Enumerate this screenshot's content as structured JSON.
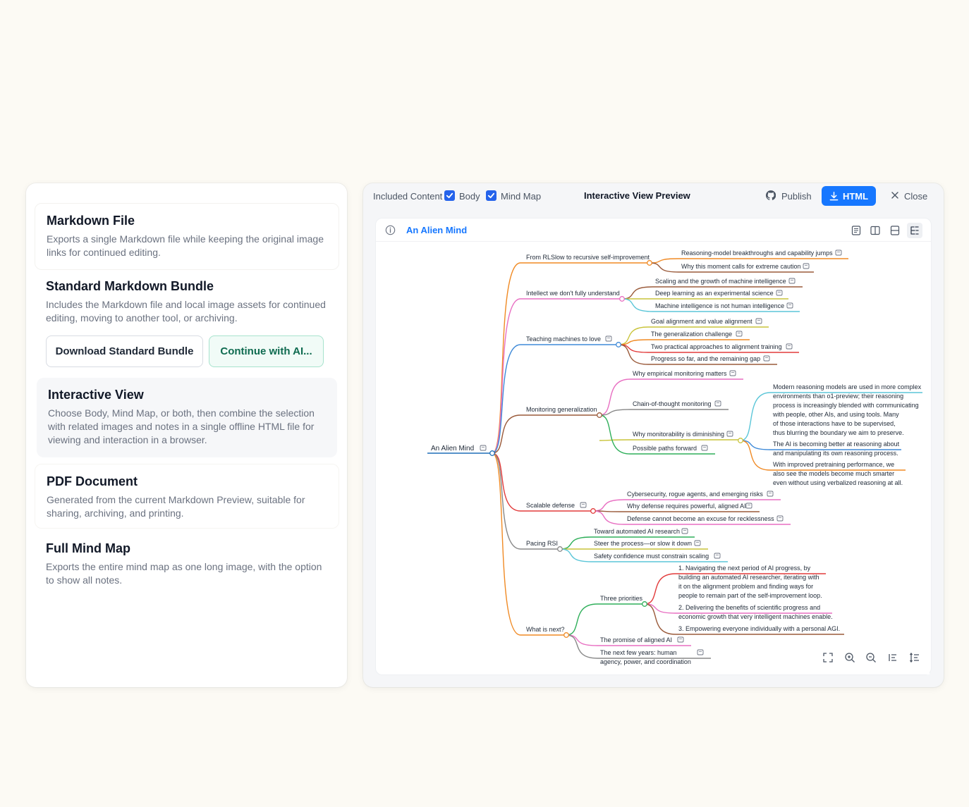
{
  "export_options": {
    "markdown": {
      "title": "Markdown File",
      "desc": "Exports a single Markdown file while keeping the original image links for continued editing."
    },
    "bundle": {
      "title": "Standard Markdown Bundle",
      "desc": "Includes the Markdown file and local image assets for continued editing, moving to another tool, or archiving.",
      "download_label": "Download Standard Bundle",
      "continue_label": "Continue with AI..."
    },
    "interactive": {
      "title": "Interactive View",
      "desc": "Choose Body, Mind Map, or both, then combine the selection with related images and notes in a single offline HTML file for viewing and interaction in a browser."
    },
    "pdf": {
      "title": "PDF Document",
      "desc": "Generated from the current Markdown Preview, suitable for sharing, archiving, and printing."
    },
    "mindmap": {
      "title": "Full Mind Map",
      "desc": "Exports the entire mind map as one long image, with the option to show all notes."
    }
  },
  "topbar": {
    "included_label": "Included Content",
    "body_label": "Body",
    "body_checked": true,
    "mindmap_label": "Mind Map",
    "mindmap_checked": true,
    "title": "Interactive View Preview",
    "publish_label": "Publish",
    "html_label": "HTML",
    "close_label": "Close"
  },
  "document": {
    "title": "An Alien Mind"
  },
  "colors": {
    "accent": "#1677ff",
    "check": "#2563eb"
  },
  "mindmap": {
    "root": "An Alien Mind",
    "n_from": "From RLSlow to recursive self-improvement",
    "n_from_1": "Reasoning-model breakthroughs and capability jumps",
    "n_from_2": "Why this moment calls for extreme caution",
    "n_intellect": "Intellect we don't fully understand",
    "n_intellect_1": "Scaling and the growth of machine intelligence",
    "n_intellect_2": "Deep learning as an experimental science",
    "n_intellect_3": "Machine intelligence is not human intelligence",
    "n_teach": "Teaching machines to love",
    "n_teach_1": "Goal alignment and value alignment",
    "n_teach_2": "The generalization challenge",
    "n_teach_3": "Two practical approaches to alignment training",
    "n_teach_4": "Progress so far, and the remaining gap",
    "n_monitor": "Monitoring generalization",
    "n_monitor_1": "Why empirical monitoring matters",
    "n_monitor_2": "Chain-of-thought monitoring",
    "n_monitor_3": "Why monitorability is diminishing",
    "n_monitor_4": "Possible paths forward",
    "n_mon3_a": [
      "Modern reasoning models are used in more complex",
      "environments than o1-preview; their reasoning",
      "process is increasingly blended with communicating",
      "with people, other AIs, and using tools. Many",
      "of those interactions have to be supervised,",
      "thus blurring the boundary we aim to preserve."
    ],
    "n_mon3_b": [
      "The AI is becoming better at reasoning about",
      "and manipulating its own reasoning process."
    ],
    "n_mon3_c": [
      "With improved pretraining performance, we",
      "also see the models become much smarter",
      "even without using verbalized reasoning at all."
    ],
    "n_scal": "Scalable defense",
    "n_scal_1": "Cybersecurity, rogue agents, and emerging risks",
    "n_scal_2": "Why defense requires powerful, aligned AI",
    "n_scal_3": "Defense cannot become an excuse for recklessness",
    "n_pacing": "Pacing RSI",
    "n_pacing_1": "Toward automated AI research",
    "n_pacing_2": "Steer the process—or slow it down",
    "n_pacing_3": "Safety confidence must constrain scaling",
    "n_next": "What is next?",
    "n_next_1": "Three priorities",
    "n_next_2": "The promise of aligned AI",
    "n_next_3": [
      "The next few years: human",
      "agency, power, and coordination"
    ],
    "n_pri_1": [
      "1. Navigating the next period of AI progress, by",
      "building an automated AI researcher, iterating with",
      "it on the alignment problem and finding ways for",
      "people to remain part of the self-improvement loop."
    ],
    "n_pri_2": [
      "2. Delivering the benefits of scientific progress and",
      "economic growth that very intelligent machines enable."
    ],
    "n_pri_3": [
      "3. Empowering everyone individually with a personal AGI."
    ]
  }
}
